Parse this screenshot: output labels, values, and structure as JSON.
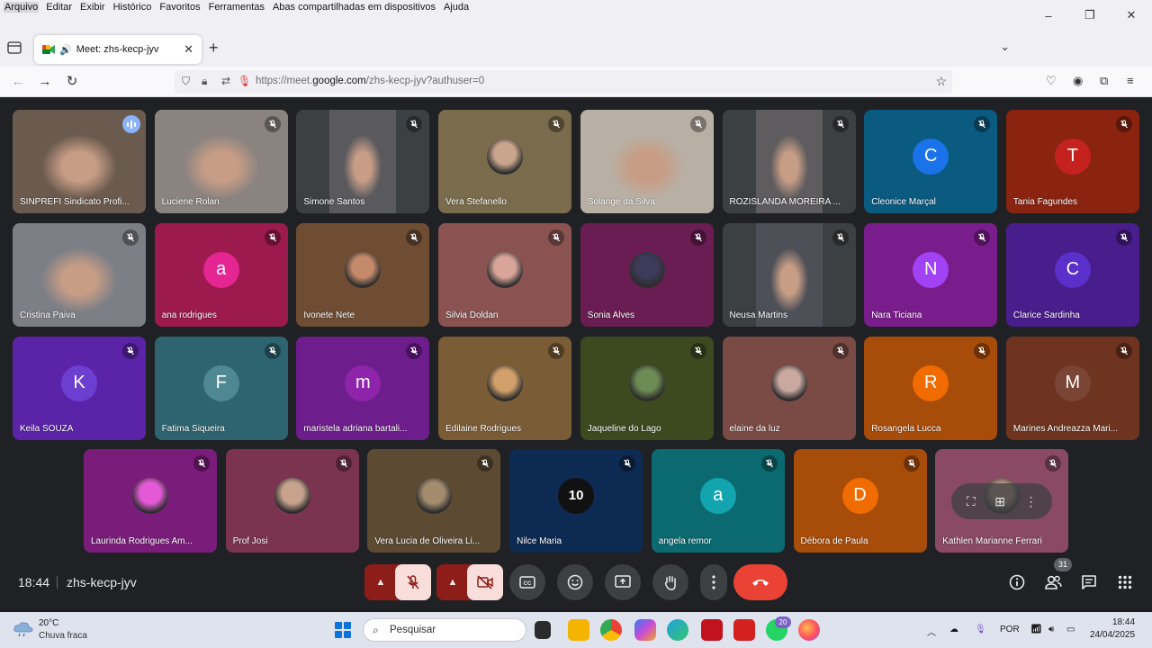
{
  "menu": [
    "Arquivo",
    "Editar",
    "Exibir",
    "Histórico",
    "Favoritos",
    "Ferramentas",
    "Abas compartilhadas em dispositivos",
    "Ajuda"
  ],
  "window_controls": {
    "minimize": "–",
    "restore": "❐",
    "close": "✕"
  },
  "tab": {
    "title": "Meet: zhs-kecp-jyv",
    "close": "✕",
    "new_tab": "+"
  },
  "url": {
    "prefix": "https://meet.",
    "domain": "google.com",
    "path": "/zhs-kecp-jyv?authuser=0"
  },
  "participants": [
    {
      "name": "SINPREFI Sindicato Profi...",
      "type": "video",
      "bg": "#6b5a4e",
      "active": true
    },
    {
      "name": "Luciene Rolan",
      "type": "video",
      "bg": "#8a8380"
    },
    {
      "name": "Simone Santos",
      "type": "video",
      "bg": "#5a5a5e"
    },
    {
      "name": "Vera Stefanello",
      "type": "photo",
      "bg": "#7a6b4c",
      "photo": "#c9a58d"
    },
    {
      "name": "Solange da Silva",
      "type": "video",
      "bg": "#b8b0a4"
    },
    {
      "name": "ROZISLANDA MOREIRA ...",
      "type": "video",
      "bg": "#5e5c5e"
    },
    {
      "name": "Cleonice Marçal",
      "type": "letter",
      "letter": "C",
      "bg": "#0b5a80",
      "avatar": "#1a73e8"
    },
    {
      "name": "Tania Fagundes",
      "type": "letter",
      "letter": "T",
      "bg": "#8a2410",
      "avatar": "#c5221f"
    },
    {
      "name": "Cristina Paiva",
      "type": "video",
      "bg": "#7d7f86"
    },
    {
      "name": "ana rodrigues",
      "type": "letter",
      "letter": "a",
      "bg": "#9d1a4e",
      "avatar": "#e52592"
    },
    {
      "name": "Ivonete Nete",
      "type": "photo",
      "bg": "#6e4d33",
      "photo": "#c58a6b"
    },
    {
      "name": "Silvia Doldan",
      "type": "photo",
      "bg": "#8a5352",
      "photo": "#d9a59a"
    },
    {
      "name": "Sonia Alves",
      "type": "photo",
      "bg": "#6a1d52",
      "photo": "#3e3a5a"
    },
    {
      "name": "Neusa Martins",
      "type": "video",
      "bg": "#4e5058"
    },
    {
      "name": "Nara Ticiana",
      "type": "letter",
      "letter": "N",
      "bg": "#7a1d8c",
      "avatar": "#a142f4"
    },
    {
      "name": "Clarice Sardinha",
      "type": "letter",
      "letter": "C",
      "bg": "#4a1d8c",
      "avatar": "#5b2fc9"
    },
    {
      "name": "Keila SOUZA",
      "type": "letter",
      "letter": "K",
      "bg": "#5b24a8",
      "avatar": "#6c3fd1"
    },
    {
      "name": "Fatima Siqueira",
      "type": "letter",
      "letter": "F",
      "bg": "#2d6470",
      "avatar": "#4f8893"
    },
    {
      "name": "maristela adriana bartali...",
      "type": "letter",
      "letter": "m",
      "bg": "#6e1d8c",
      "avatar": "#8e24aa"
    },
    {
      "name": "Edilaine Rodrigues",
      "type": "photo",
      "bg": "#7a5c36",
      "photo": "#d1a06b"
    },
    {
      "name": "Jaqueline do Lago",
      "type": "photo",
      "bg": "#3d4a1f",
      "photo": "#6d8b55"
    },
    {
      "name": "elaine da luz",
      "type": "photo",
      "bg": "#7a4a45",
      "photo": "#c9a8a0"
    },
    {
      "name": "Rosangela Lucca",
      "type": "letter",
      "letter": "R",
      "bg": "#a84c0a",
      "avatar": "#f06c00"
    },
    {
      "name": "Marines Andreazza Mari...",
      "type": "letter",
      "letter": "M",
      "bg": "#6e3420",
      "avatar": "#7a4535"
    },
    {
      "name": "Laurinda Rodrigues Am...",
      "type": "photo",
      "bg": "#7a1d7a",
      "photo": "#e45ad6"
    },
    {
      "name": "Prof Josi",
      "type": "photo",
      "bg": "#7a3450",
      "photo": "#c7a38e"
    },
    {
      "name": "Vera Lucia de Oliveira Li...",
      "type": "photo",
      "bg": "#5c4a33",
      "photo": "#a38b6e"
    },
    {
      "name": "Nilce Maria",
      "type": "photo",
      "bg": "#0d2a52",
      "photo": "#111111",
      "photo_text": "10"
    },
    {
      "name": "angela remor",
      "type": "letter",
      "letter": "a",
      "bg": "#0b6a70",
      "avatar": "#12a4af"
    },
    {
      "name": "Débora de Paula",
      "type": "letter",
      "letter": "D",
      "bg": "#a84c0a",
      "avatar": "#f06c00"
    },
    {
      "name": "Kathlen Marianne Ferrari",
      "type": "photo",
      "bg": "#8a4a66",
      "photo": "#b89080",
      "hover": true
    }
  ],
  "meeting": {
    "time": "18:44",
    "code": "zhs-kecp-jyv",
    "participant_count": "31"
  },
  "taskbar": {
    "temp": "20°C",
    "weather": "Chuva fraca",
    "search_placeholder": "Pesquisar",
    "whatsapp_badge": "20",
    "language": "POR",
    "clock_time": "18:44",
    "clock_date": "24/04/2025"
  }
}
